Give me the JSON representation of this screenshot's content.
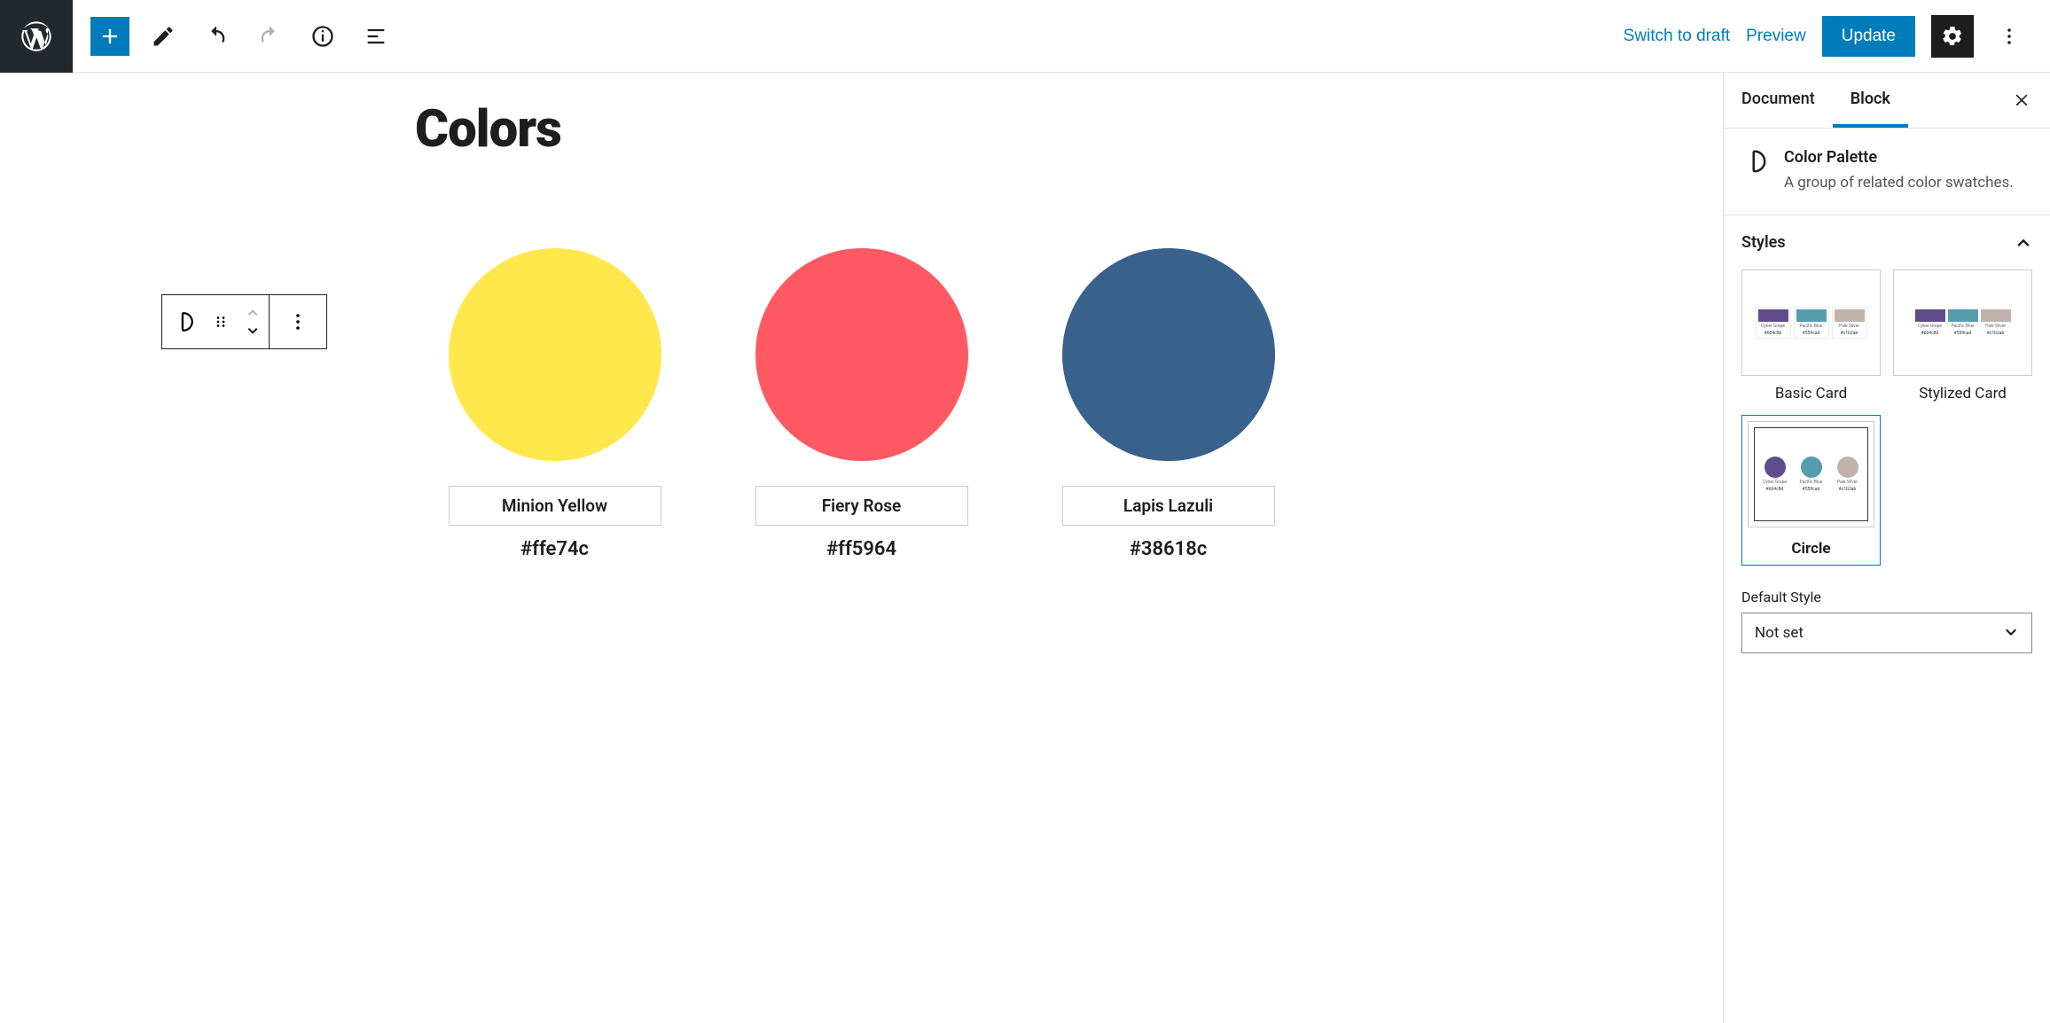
{
  "header": {
    "switch_to_draft": "Switch to draft",
    "preview": "Preview",
    "update": "Update"
  },
  "editor": {
    "title": "Colors",
    "swatches": [
      {
        "color": "#ffe74c",
        "name": "Minion Yellow",
        "hex": "#ffe74c"
      },
      {
        "color": "#ff5964",
        "name": "Fiery Rose",
        "hex": "#ff5964"
      },
      {
        "color": "#38618c",
        "name": "Lapis Lazuli",
        "hex": "#38618c"
      }
    ]
  },
  "sidebar": {
    "tabs": {
      "document": "Document",
      "block": "Block"
    },
    "block_name": "Color Palette",
    "block_description": "A group of related color swatches.",
    "styles_title": "Styles",
    "styles": [
      {
        "label": "Basic Card",
        "selected": false,
        "kind": "basic"
      },
      {
        "label": "Stylized Card",
        "selected": false,
        "kind": "stylized"
      },
      {
        "label": "Circle",
        "selected": true,
        "kind": "circle"
      }
    ],
    "style_mini": [
      {
        "color": "#604c8d",
        "name": "Cyber Grape",
        "hex": "#604c8d"
      },
      {
        "color": "#559cad",
        "name": "Pacific Blue",
        "hex": "#559cad"
      },
      {
        "color": "#c1b2ab",
        "name": "Pale Silver",
        "hex": "#c1b2ab"
      }
    ],
    "default_style_label": "Default Style",
    "default_style_value": "Not set"
  }
}
